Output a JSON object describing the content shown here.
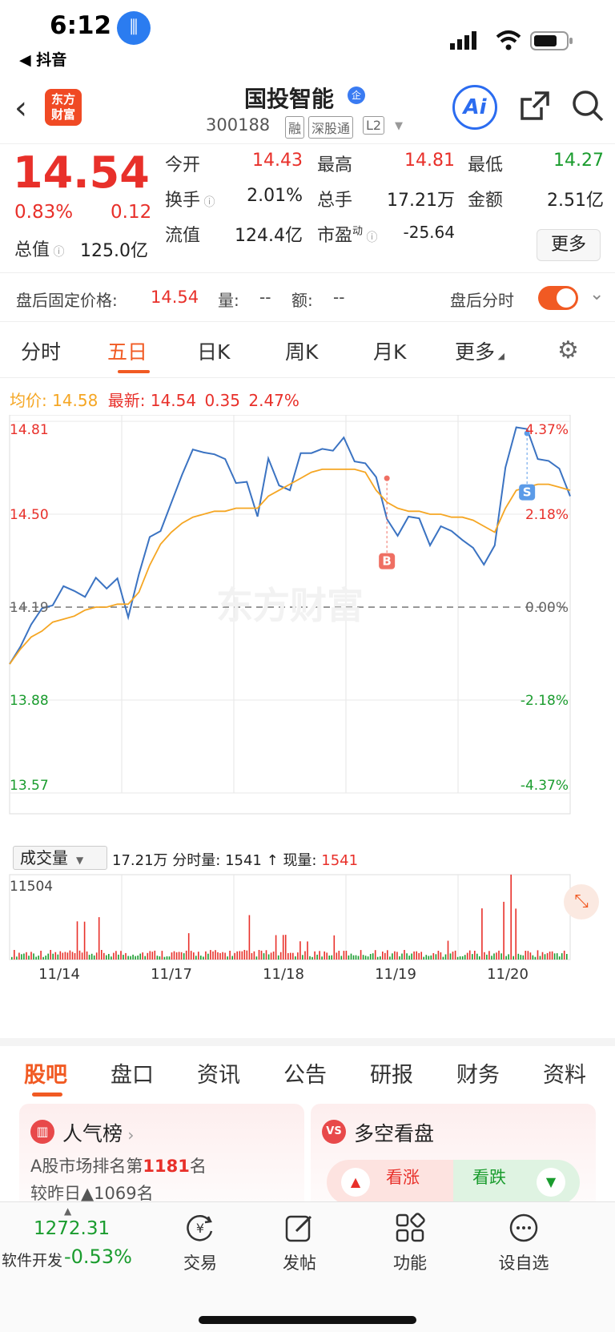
{
  "status": {
    "time": "6:12",
    "back_app": "◀ 抖音"
  },
  "header": {
    "stock_name": "国投智能",
    "enterprise_badge": "企",
    "stock_code": "300188",
    "tags": [
      "融",
      "深股通",
      "L2"
    ],
    "logo_line1": "东方",
    "logo_line2": "财富",
    "ai_label": "Ai"
  },
  "quote": {
    "price": "14.54",
    "change_pct": "0.83%",
    "change": "0.12",
    "open_label": "今开",
    "open": "14.43",
    "high_label": "最高",
    "high": "14.81",
    "low_label": "最低",
    "low": "14.27",
    "turnover_label": "换手",
    "turnover": "2.01%",
    "volume_label": "总手",
    "volume": "17.21万",
    "amount_label": "金额",
    "amount": "2.51亿",
    "total_value_label": "总值",
    "total_value": "125.0亿",
    "float_value_label": "流值",
    "float_value": "124.4亿",
    "pe_label": "市盈",
    "pe_sup": "动",
    "pe": "-25.64",
    "more_label": "更多"
  },
  "afterhours": {
    "label": "盘后固定价格:",
    "price": "14.54",
    "vol_label": "量:",
    "vol": "--",
    "amt_label": "额:",
    "amt": "--",
    "timeshare_label": "盘后分时"
  },
  "chart_tabs": [
    "分时",
    "五日",
    "日K",
    "周K",
    "月K",
    "更多"
  ],
  "chart_header": {
    "avg_label": "均价:",
    "avg": "14.58",
    "latest_label": "最新:",
    "latest": "14.54",
    "latest_change": "0.35",
    "latest_pct": "2.47%"
  },
  "chart_data": {
    "type": "line",
    "x_dates": [
      "11/14",
      "11/17",
      "11/18",
      "11/19",
      "11/20"
    ],
    "price_axis": [
      "14.81",
      "14.50",
      "14.19",
      "13.88",
      "13.57"
    ],
    "pct_axis": [
      "4.37%",
      "2.18%",
      "0.00%",
      "-2.18%",
      "-4.37%"
    ],
    "ylim": [
      13.57,
      14.81
    ],
    "prev_close": 14.19,
    "series": [
      {
        "name": "价格",
        "color": "#3b73c2",
        "values": [
          14.0,
          14.07,
          14.12,
          14.15,
          14.22,
          14.26,
          14.22,
          14.26,
          14.3,
          14.24,
          14.25,
          14.18,
          14.3,
          14.4,
          14.48,
          14.55,
          14.62,
          14.68,
          14.73,
          14.7,
          14.66,
          14.64,
          14.62,
          14.48,
          14.65,
          14.62,
          14.58,
          14.68,
          14.74,
          14.73,
          14.7,
          14.72,
          14.7,
          14.67,
          14.6,
          14.52,
          14.44,
          14.48,
          14.45,
          14.42,
          14.46,
          14.42,
          14.45,
          14.4,
          14.32,
          14.36,
          14.68,
          14.79,
          14.76,
          14.72,
          14.69,
          14.64,
          14.56
        ]
      },
      {
        "name": "均价",
        "color": "#f5a623",
        "values": [
          14.0,
          14.05,
          14.09,
          14.11,
          14.14,
          14.15,
          14.16,
          14.18,
          14.19,
          14.19,
          14.2,
          14.2,
          14.24,
          14.33,
          14.4,
          14.44,
          14.47,
          14.49,
          14.5,
          14.51,
          14.51,
          14.52,
          14.52,
          14.52,
          14.56,
          14.58,
          14.6,
          14.62,
          14.64,
          14.65,
          14.65,
          14.65,
          14.65,
          14.64,
          14.58,
          14.54,
          14.52,
          14.51,
          14.51,
          14.5,
          14.5,
          14.49,
          14.49,
          14.48,
          14.46,
          14.44,
          14.52,
          14.58,
          14.59,
          14.6,
          14.6,
          14.59,
          14.58
        ]
      }
    ],
    "markers": [
      {
        "label": "B",
        "color": "#ef6f63",
        "price": 14.62,
        "index": 35
      },
      {
        "label": "S",
        "color": "#5b9be8",
        "price": 14.77,
        "index": 48
      }
    ],
    "volume": {
      "max_label": "11504",
      "peaks": [
        0.36,
        0.5,
        0.56,
        0.54,
        0.35,
        0.6,
        0.33,
        0.24,
        0.32,
        0.3,
        0.25,
        0.68,
        1.0,
        0.3
      ]
    }
  },
  "volume_header": {
    "select_label": "成交量",
    "total": "17.21万",
    "timeshare_label": "分时量:",
    "timeshare": "1541 ↑",
    "current_label": "现量:",
    "current": "1541"
  },
  "info_tabs": [
    "股吧",
    "盘口",
    "资讯",
    "公告",
    "研报",
    "财务",
    "资料"
  ],
  "cards": {
    "rank_title": "人气榜",
    "rank_line1_prefix": "A股市场排名第",
    "rank_number": "1181",
    "rank_line1_suffix": "名",
    "rank_line2": "较昨日▲1069名",
    "ls_title": "多空看盘",
    "ls_icon": "VS",
    "bull_label": "看涨",
    "bear_label": "看跌"
  },
  "bottombar": {
    "index_value": "1272.31",
    "index_name": "软件开发",
    "index_change": "-0.53%",
    "items": [
      "交易",
      "发帖",
      "功能",
      "设自选"
    ]
  },
  "colors": {
    "accent": "#f15a23",
    "up": "#e8302a",
    "down": "#1a9c2e"
  }
}
